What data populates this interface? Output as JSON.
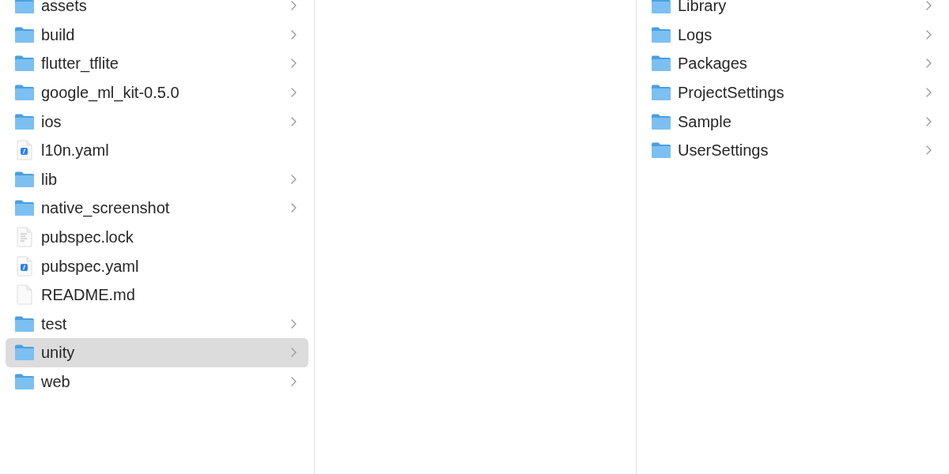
{
  "columns": [
    {
      "items": [
        {
          "name": "assets",
          "kind": "folder",
          "selected": false
        },
        {
          "name": "build",
          "kind": "folder",
          "selected": false
        },
        {
          "name": "flutter_tflite",
          "kind": "folder",
          "selected": false
        },
        {
          "name": "google_ml_kit-0.5.0",
          "kind": "folder",
          "selected": false
        },
        {
          "name": "ios",
          "kind": "folder",
          "selected": false
        },
        {
          "name": "l10n.yaml",
          "kind": "yaml",
          "selected": false
        },
        {
          "name": "lib",
          "kind": "folder",
          "selected": false
        },
        {
          "name": "native_screenshot",
          "kind": "folder",
          "selected": false
        },
        {
          "name": "pubspec.lock",
          "kind": "text",
          "selected": false
        },
        {
          "name": "pubspec.yaml",
          "kind": "yaml",
          "selected": false
        },
        {
          "name": "README.md",
          "kind": "blank",
          "selected": false
        },
        {
          "name": "test",
          "kind": "folder",
          "selected": false
        },
        {
          "name": "unity",
          "kind": "folder",
          "selected": true
        },
        {
          "name": "web",
          "kind": "folder",
          "selected": false
        }
      ]
    },
    {
      "items": [
        {
          "name": "Library",
          "kind": "folder",
          "selected": false
        },
        {
          "name": "Logs",
          "kind": "folder",
          "selected": false
        },
        {
          "name": "Packages",
          "kind": "folder",
          "selected": false
        },
        {
          "name": "ProjectSettings",
          "kind": "folder",
          "selected": false
        },
        {
          "name": "Sample",
          "kind": "folder",
          "selected": false
        },
        {
          "name": "UserSettings",
          "kind": "folder",
          "selected": false
        }
      ]
    }
  ]
}
